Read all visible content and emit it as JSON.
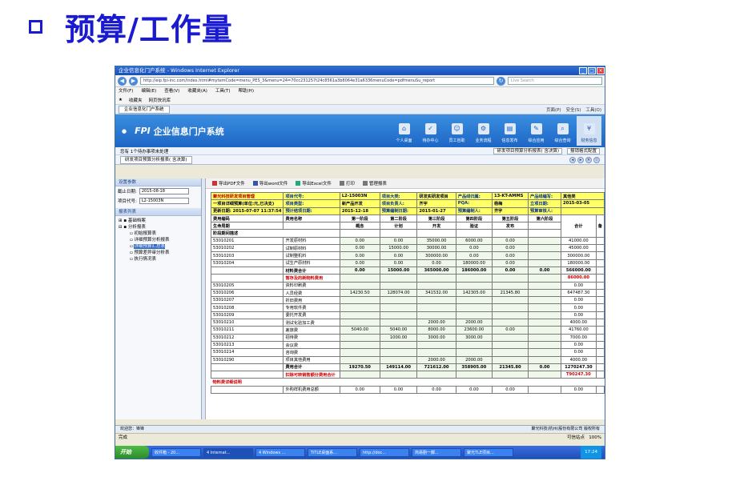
{
  "slide": {
    "title": "预算/工作量"
  },
  "browser": {
    "window_title": "企业信息化门户系统 - Windows Internet Explorer",
    "address": "http://eip.fpi-inc.com/index.html#mytemCode=menu_PES_3&menu=24=70cc231257t24c8561a3b8064e31a6336menuCode=pdfmenuSu_report",
    "search_placeholder": "Live Search",
    "menu": [
      "文件(F)",
      "编辑(E)",
      "查看(V)",
      "收藏夹(A)",
      "工具(T)",
      "帮助(H)"
    ],
    "favorites": [
      "收藏夹",
      "网页快讯库"
    ],
    "tab_label": "企业信息化门户系统",
    "tab_tools": [
      "页面(P)",
      "安全(S)",
      "工具(O)"
    ]
  },
  "portal": {
    "logo": "FPI",
    "system_name": "企业信息门户系统",
    "nav": [
      "个人桌面",
      "待办中心",
      "员工自助",
      "业务流程",
      "信息发布",
      "综合应用",
      "综合查询",
      "财务信息"
    ],
    "notice": "您有 1个待办事项未处理",
    "notice_tab": "研发项目预算分析报表( 含决算)",
    "notice_config": "报销格式配置",
    "page_tab": "研发项目预算分析报表( 含决算)"
  },
  "left_panel": {
    "header": "设置参数",
    "deadline_label": "截止日期:",
    "deadline_value": "2015-08-18",
    "code_label": "项目代号:",
    "code_value": "L2-15003N",
    "list_header": "报表列表",
    "tree": [
      "基础档案",
      "分析报表",
      "初始报算表",
      "详细预算分析报表",
      "详细预算汇总表",
      "预算差异审分析表",
      "执行情况表"
    ]
  },
  "toolbar": [
    "导出PDF文件",
    "导出word文件",
    "导出Excel文件",
    "打印",
    "管理报表"
  ],
  "report": {
    "info": [
      [
        "聚光科技研发项目管理",
        "项目代号:",
        "L2-15003N",
        "项目大类:",
        "研发实研发项目",
        "产品线归属:",
        "13-KT-AMMS",
        "产品线编写:",
        "其他类"
      ],
      [
        "一项目详细预算(单位:元,已决支)",
        "项目类型:",
        "新产品开发",
        "项目负责人:",
        "齐宇",
        "PQA:",
        "杨梅",
        "立项日期:",
        "2015-03-05"
      ],
      [
        "更新日期: 2015-07-07 11:37:54",
        "预计结项日期:",
        "2015-12-18",
        "预算编制日期:",
        "2015-01-27",
        "预算编制人:",
        "齐宇",
        "预算审核人:",
        ""
      ]
    ],
    "col_heads_1": [
      "费用编码",
      "费用名称",
      "第一阶段",
      "第二阶段",
      "第三阶段",
      "第四阶段",
      "第五阶段",
      "第六阶段",
      "合计",
      "备"
    ],
    "col_heads_2": [
      "生命周期",
      "",
      "概念",
      "计划",
      "开发",
      "验证",
      "发布"
    ],
    "col_heads_3": [
      "阶段期间描述"
    ],
    "rows": [
      [
        "53010201",
        "开发原材料",
        "0.00",
        "0.00",
        "35000.00",
        "6000.00",
        "0.00",
        "",
        "41000.00"
      ],
      [
        "53010202",
        "试制原材料",
        "0.00",
        "15000.00",
        "30000.00",
        "0.00",
        "0.00",
        "",
        "45000.00"
      ],
      [
        "53010203",
        "试制整机料",
        "0.00",
        "0.00",
        "300000.00",
        "0.00",
        "0.00",
        "",
        "300000.00"
      ],
      [
        "53010204",
        "试生产原材料",
        "0.00",
        "0.00",
        "0.00",
        "180000.00",
        "0.00",
        "",
        "180000.00"
      ],
      [
        "",
        "材料费合计",
        "0.00",
        "15000.00",
        "365000.00",
        "186000.00",
        "0.00",
        "0.00",
        "566000.00"
      ],
      [
        "",
        "暂存及的耗物料费用",
        "",
        "",
        "",
        "",
        "",
        "",
        "86000.00"
      ],
      [
        "53010205",
        "资料印刷费",
        "",
        "",
        "",
        "",
        "",
        "",
        "0.00"
      ],
      [
        "53010206",
        "人员经费",
        "14230.50",
        "128074.00",
        "341532.00",
        "142305.00",
        "21345.80",
        "",
        "647487.30"
      ],
      [
        "53010207",
        "折旧费用",
        "",
        "",
        "",
        "",
        "",
        "",
        "0.00"
      ],
      [
        "53010208",
        "专用软件费",
        "",
        "",
        "",
        "",
        "",
        "",
        "0.00"
      ],
      [
        "53010209",
        "委托开发费",
        "",
        "",
        "",
        "",
        "",
        "",
        "0.00"
      ],
      [
        "53010210",
        "测试化验加工费",
        "",
        "",
        "2000.00",
        "2000.00",
        "",
        "",
        "4000.00"
      ],
      [
        "53010211",
        "差旅费",
        "5040.00",
        "5040.00",
        "8000.00",
        "23600.00",
        "0.00",
        "",
        "41760.00"
      ],
      [
        "53010212",
        "招待费",
        "",
        "1000.00",
        "3000.00",
        "3000.00",
        "",
        "",
        "7000.00"
      ],
      [
        "53010213",
        "会议费",
        "",
        "",
        "",
        "",
        "",
        "",
        "0.00"
      ],
      [
        "53010214",
        "咨询费",
        "",
        "",
        "",
        "",
        "",
        "",
        "0.00"
      ],
      [
        "53010290",
        "项目其他费用",
        "",
        "",
        "2000.00",
        "2000.00",
        "",
        "",
        "4000.00"
      ],
      [
        "",
        "费用合计",
        "19270.50",
        "149114.00",
        "721612.00",
        "358905.00",
        "21345.80",
        "0.00",
        "1270247.30"
      ],
      [
        "",
        "扣除可转销售额分费用合计",
        "",
        "",
        "",
        "",
        "",
        "",
        "T90247.30"
      ]
    ],
    "section_label": "物料费详细说明",
    "last_row": [
      "",
      "外购样机费用总额",
      "0.00",
      "0.00",
      "0.00",
      "0.00",
      "0.00",
      "",
      "0.00"
    ]
  },
  "status": {
    "welcome": "欢迎您：锋锋",
    "copyright": "聚光科技(杭州)股份有限公司 版权所有",
    "ie_status": "完成",
    "trusted": "可信站点",
    "zoom": "100%"
  },
  "taskbar": {
    "start": "开始",
    "tasks": [
      "收件箱 - 20...",
      "4 Internat...",
      "4 Windows ...",
      "TiTLE桌面系...",
      "http://doc...",
      "简易剧一脚...",
      "聚光TLE项目..."
    ],
    "clock": "17:24"
  }
}
